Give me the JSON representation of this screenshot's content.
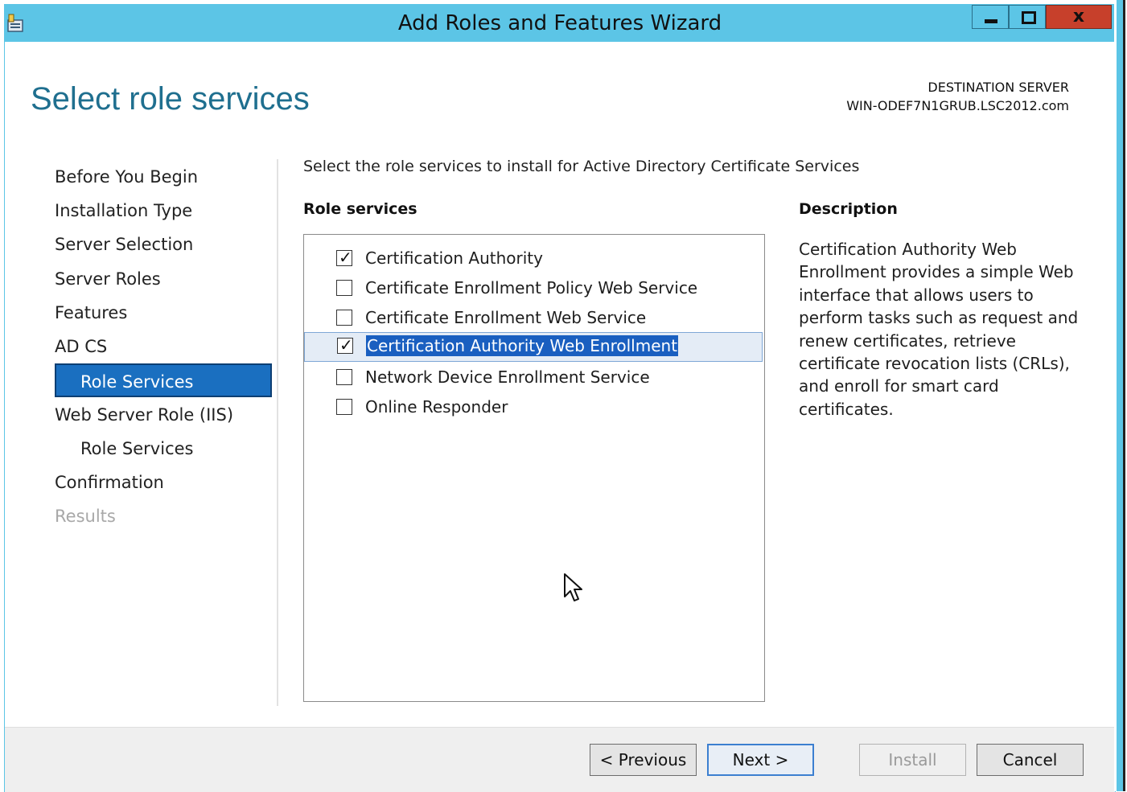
{
  "window": {
    "title": "Add Roles and Features Wizard",
    "controls": {
      "close_label": "x"
    },
    "colors": {
      "titlebar": "#5cc5e6",
      "close": "#c7402b",
      "accent": "#1a6fc0",
      "page_title": "#1f6f8f"
    }
  },
  "header": {
    "page_title": "Select role services",
    "destination_label": "DESTINATION SERVER",
    "destination_server": "WIN-ODEF7N1GRUB.LSC2012.com"
  },
  "nav": {
    "items": [
      {
        "label": "Before You Begin",
        "state": "normal"
      },
      {
        "label": "Installation Type",
        "state": "normal"
      },
      {
        "label": "Server Selection",
        "state": "normal"
      },
      {
        "label": "Server Roles",
        "state": "normal"
      },
      {
        "label": "Features",
        "state": "normal"
      },
      {
        "label": "AD CS",
        "state": "normal"
      },
      {
        "label": "Role Services",
        "state": "active"
      },
      {
        "label": "Web Server Role (IIS)",
        "state": "normal"
      },
      {
        "label": "Role Services",
        "state": "normal"
      },
      {
        "label": "Confirmation",
        "state": "normal"
      },
      {
        "label": "Results",
        "state": "disabled"
      }
    ]
  },
  "main": {
    "instruction": "Select the role services to install for Active Directory Certificate Services",
    "role_services_heading": "Role services",
    "description_heading": "Description",
    "role_services": [
      {
        "label": "Certification Authority",
        "checked": true,
        "selected": false
      },
      {
        "label": "Certificate Enrollment Policy Web Service",
        "checked": false,
        "selected": false
      },
      {
        "label": "Certificate Enrollment Web Service",
        "checked": false,
        "selected": false
      },
      {
        "label": "Certification Authority Web Enrollment",
        "checked": true,
        "selected": true
      },
      {
        "label": "Network Device Enrollment Service",
        "checked": false,
        "selected": false
      },
      {
        "label": "Online Responder",
        "checked": false,
        "selected": false
      }
    ],
    "description": "Certification Authority Web Enrollment provides a simple Web interface that allows users to perform tasks such as request and renew certificates, retrieve certificate revocation lists (CRLs), and enroll for smart card certificates."
  },
  "footer": {
    "previous_label": "< Previous",
    "next_label": "Next >",
    "install_label": "Install",
    "cancel_label": "Cancel"
  }
}
